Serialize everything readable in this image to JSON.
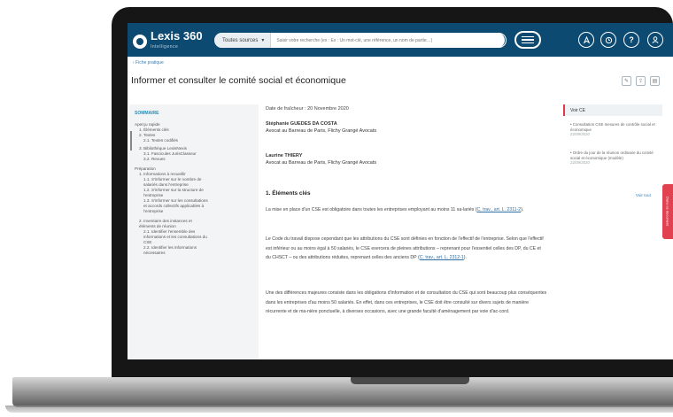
{
  "app": {
    "logo_text": "Lexis 360",
    "logo_sub": "Intelligence"
  },
  "search": {
    "scope_label": "Toutes sources",
    "placeholder": "Saisir votre recherche (ex : Ex : Un mot-clé, une référence, un nom de partie…)"
  },
  "breadcrumb": "‹ Fiche pratique",
  "page": {
    "title": "Informer et consulter le comité social et économique"
  },
  "sidebar": {
    "title": "SOMMAIRE",
    "items": [
      "Aperçu rapide",
      "1. Éléments clés",
      "2. Textes",
      "2.1. Textes codifiés",
      "3. Bibliothèque LexisNexis",
      "3.1. Fascicules JurisClasseur",
      "3.2. Revues",
      "Préparation",
      "1. Informations à recueillir",
      "1.1. S'informer sur le nombre de",
      "salariés dans l'entreprise",
      "1.2. S'informer sur la structure de",
      "l'entreprise",
      "1.3. S'informer sur les consultations",
      "et accords collectifs applicables à",
      "l'entreprise",
      "2. Inventaire des instances et",
      "éléments de réunion",
      "2.1. Identifier l'ensemble des",
      "informations et les consultations du",
      "CSE",
      "2.2. Identifier les informations",
      "nécessaires"
    ]
  },
  "content": {
    "date": "Date de fraîcheur : 20 Novembre 2020",
    "author1_name": "Stéphanie GUEDES DA COSTA",
    "author1_role": "Avocat au Barreau de Paris, Flichy Grangé Avocats",
    "author2_name": "Laurine THIERY",
    "author2_role": "Avocat au Barreau de Paris, Flichy Grangé Avocats",
    "section_title": "1. Éléments clés",
    "p1_text": "La mise en place d'un CSE est obligatoire dans toutes les entreprises employant au moins 11 sa-lariés (",
    "p1_link": "C. trav., art. L. 2311-2",
    "p1_end": ").",
    "p2_text": "Le Code du travail dispose cependant que les attributions du CSE sont définies en fonction de l'effectif de l'entreprise. Selon que l'effectif est inférieur ou au moins égal à 50 salariés, le CSE exercera de pleines attributions – reprenant pour l'essentiel celles des DP, du CE et du CHSCT – ou des attributions réduites, reprenant celles des anciens DP (",
    "p2_link": "C. trav., art. L. 2312-1",
    "p2_end": ").",
    "p3_text": "Une des différences majeures consiste dans les obligations d'information et de consultation du CSE qui sont beaucoup plus conséquentes dans les entreprises d'au moins 50 salariés. En effet, dans ces entreprises, le CSE doit être consulté sur divers sujets de manière récurrente et de ma-nière ponctuelle, à diverses occasions, avec une grande faculté d'aménagement par voie d'ac-cord."
  },
  "right_panel": {
    "heading": "Voir CE",
    "item1_text": "• Consultation CSE mesures de contrôle social et économique",
    "item1_date": "22/09/2020",
    "item2_text": "• Ordre du jour de la réunion ordinaire du comité social et économique (modèle)",
    "item2_date": "22/09/2020",
    "more_label": "Voir tout"
  },
  "side_tab_label": "Dans ce document",
  "colors": {
    "topbar": "#0d4a72",
    "accent_red": "#e2414f",
    "link_blue": "#2f6ea3"
  },
  "icons": [
    "search-icon",
    "menu-icon",
    "rocket-icon",
    "history-icon",
    "help-icon",
    "user-icon",
    "edit-icon",
    "share-icon",
    "print-icon"
  ]
}
